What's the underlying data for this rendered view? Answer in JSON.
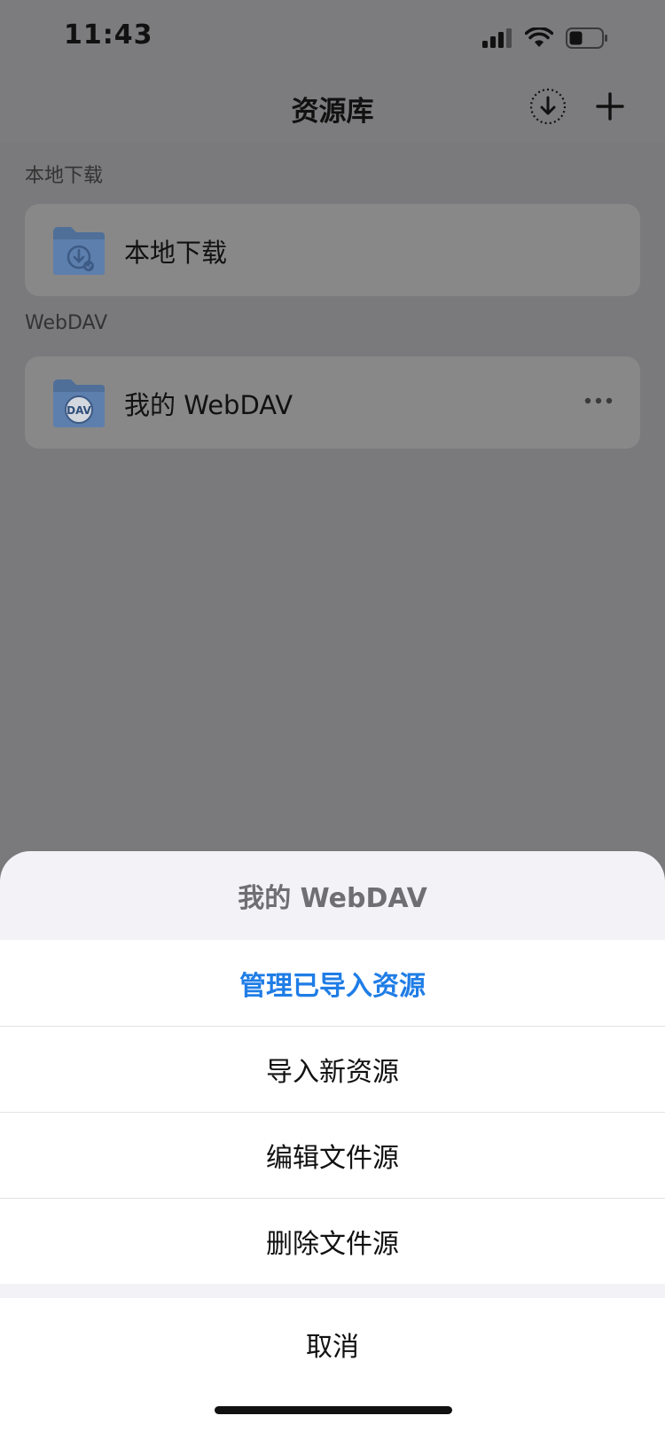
{
  "status_bar": {
    "time": "11:43",
    "icons": [
      "signal-icon",
      "wifi-icon",
      "battery-icon"
    ]
  },
  "navbar": {
    "title": "资源库",
    "icons": {
      "download": "download-circle-icon",
      "add": "plus-icon"
    }
  },
  "sections": {
    "local": {
      "label": "本地下载",
      "item_label": "本地下载",
      "icon": "folder-download-icon"
    },
    "webdav": {
      "label": "WebDAV",
      "item_label": "我的 WebDAV",
      "icon": "folder-dav-icon",
      "dav_badge": "DAV",
      "more_icon": "ellipsis-icon"
    }
  },
  "action_sheet": {
    "title": "我的 WebDAV",
    "options": [
      {
        "label": "管理已导入资源"
      },
      {
        "label": "导入新资源"
      },
      {
        "label": "编辑文件源"
      },
      {
        "label": "删除文件源"
      }
    ],
    "cancel_label": "取消"
  },
  "colors": {
    "accent": "#1f7de6",
    "dim_background": "#7a7a7c",
    "sheet_background": "#f2f2f7"
  }
}
